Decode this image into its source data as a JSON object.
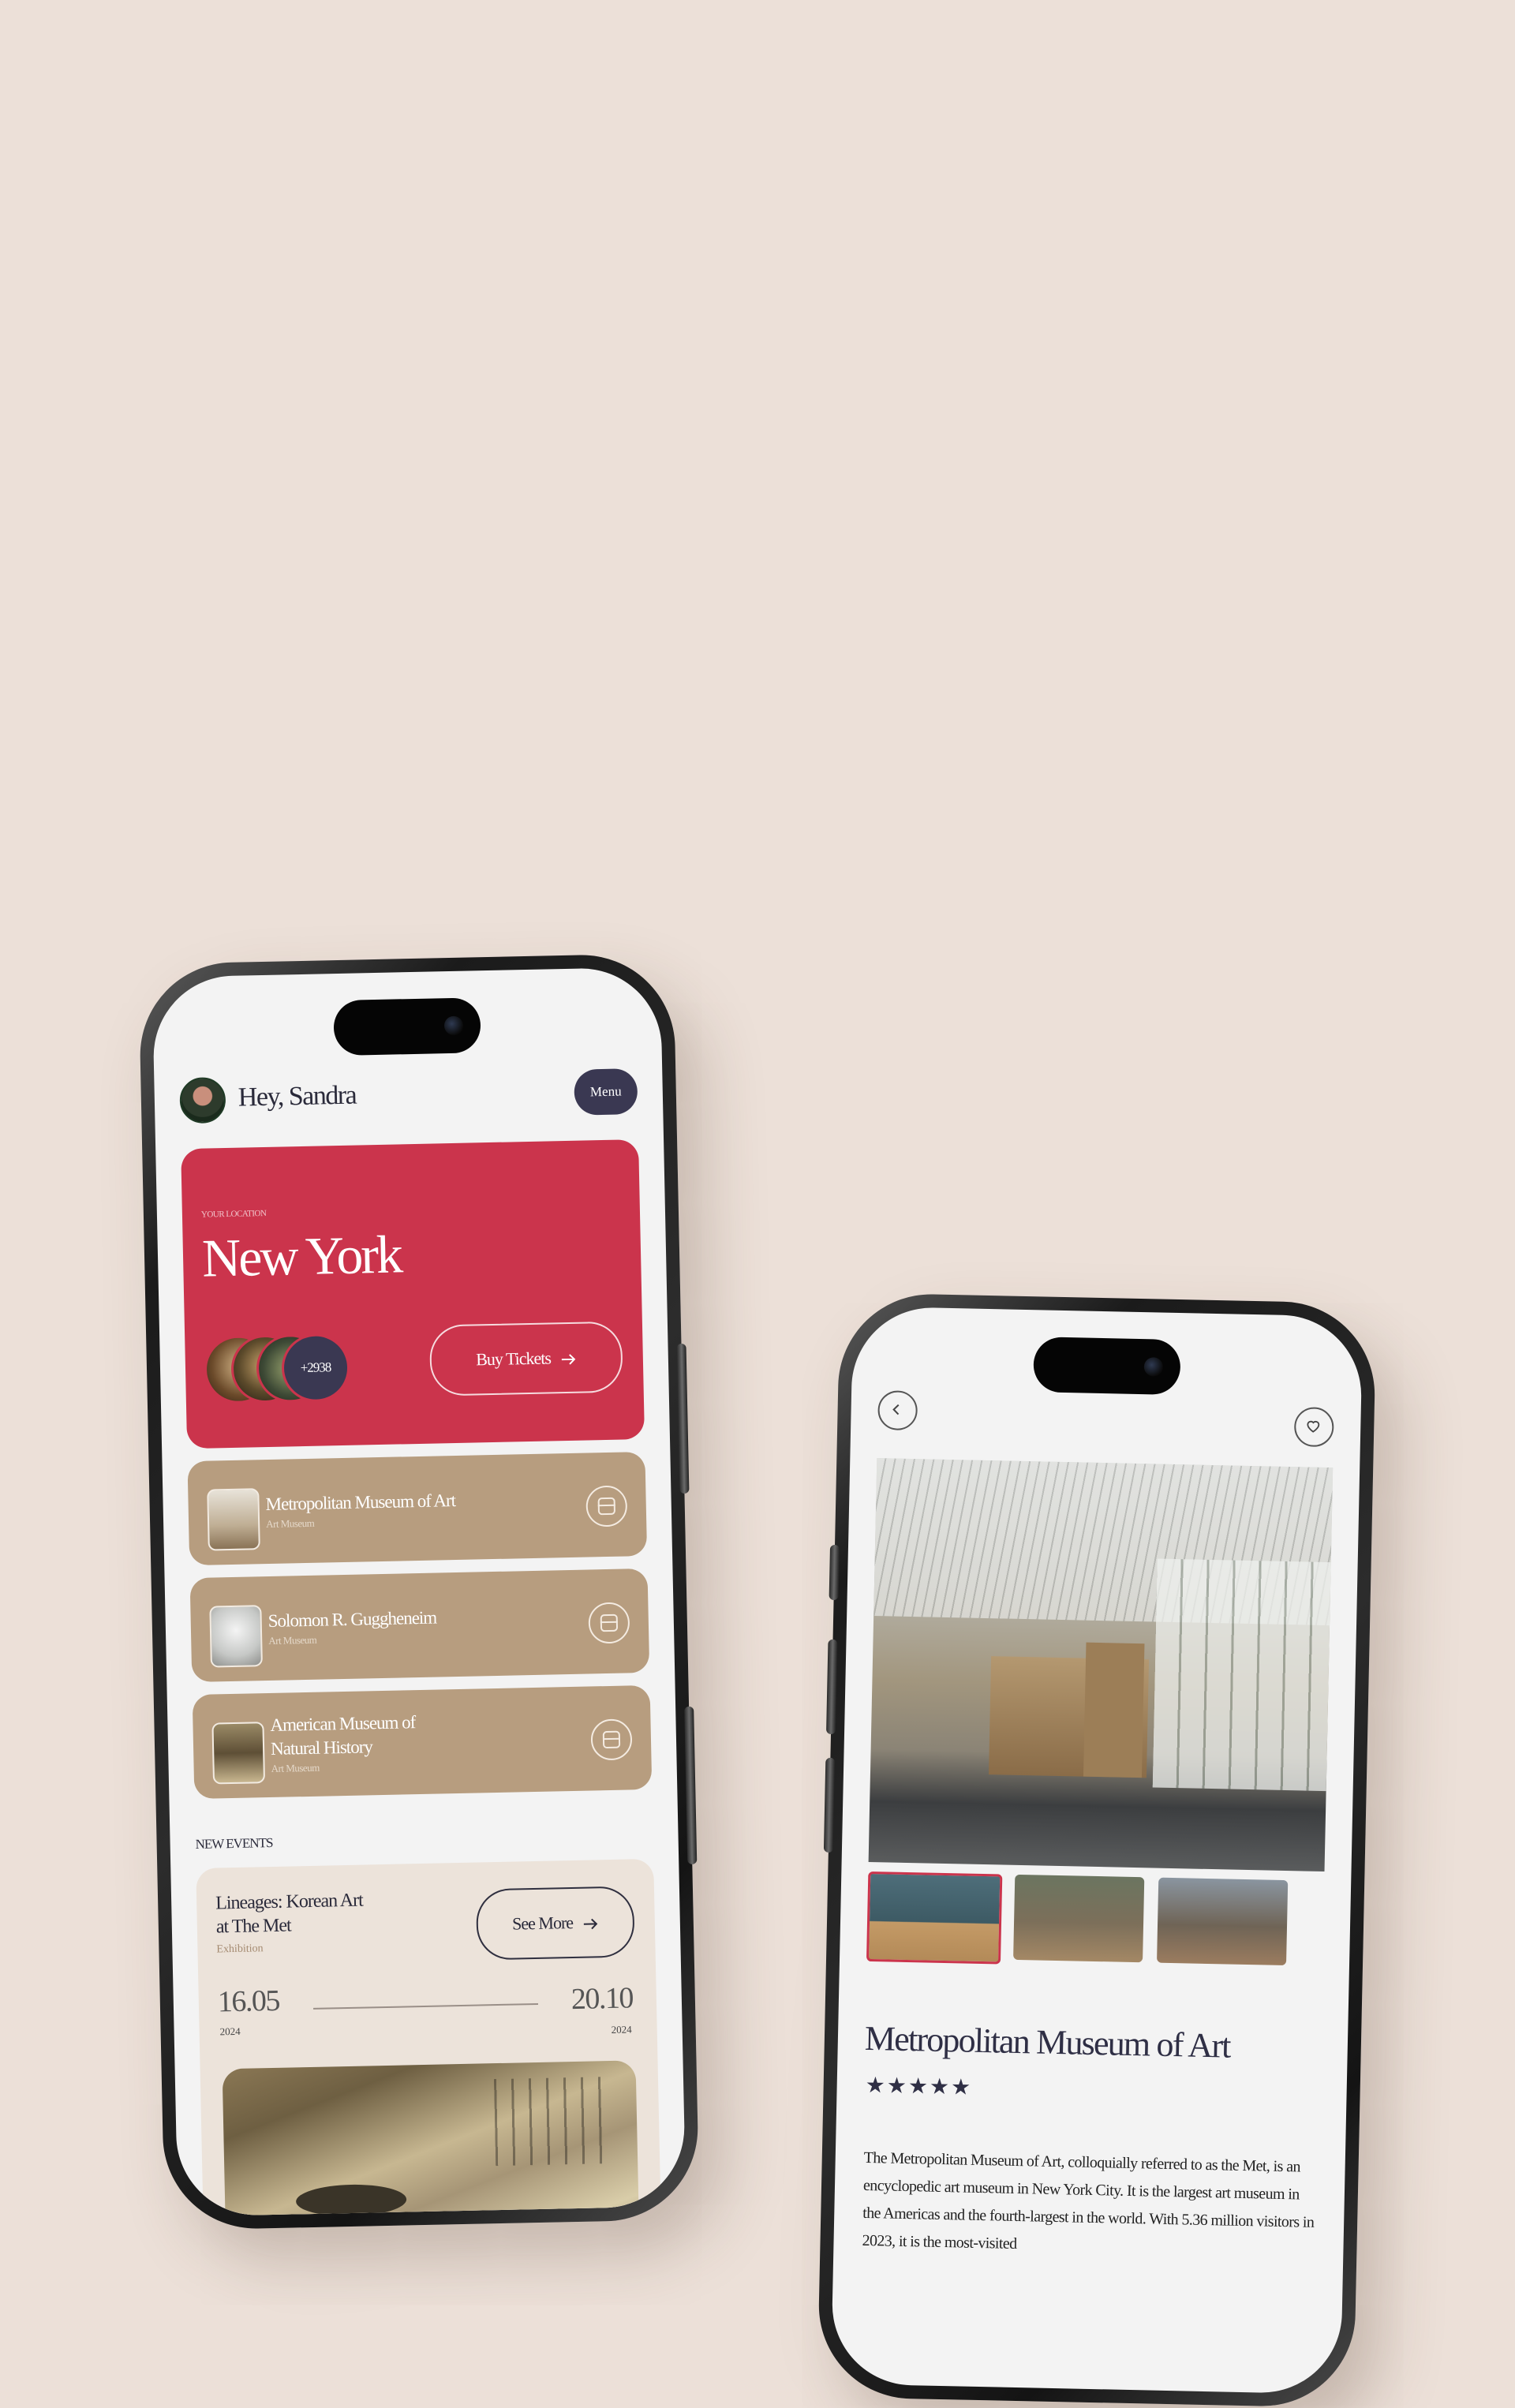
{
  "home_screen": {
    "greeting": "Hey, Sandra",
    "menu_label": "Menu",
    "location": {
      "label": "YOUR LOCATION",
      "city": "New York",
      "visitor_count": "+2938",
      "buy_tickets_label": "Buy Tickets"
    },
    "museums": [
      {
        "name": "Metropolitan Museum of Art",
        "type": "Art Museum"
      },
      {
        "name": "Solomon R. Guggheneim",
        "type": "Art Museum"
      },
      {
        "name": "American Museum of Natural History",
        "type": "Art Museum"
      }
    ],
    "section_title": "NEW EVENTS",
    "event": {
      "title": "Lineages: Korean Art at The Met",
      "type": "Exhibition",
      "see_more_label": "See More",
      "start_date": "16.05",
      "start_year": "2024",
      "end_date": "20.10",
      "end_year": "2024"
    }
  },
  "detail_screen": {
    "title": "Metropolitan Museum of Art",
    "rating": 4.5,
    "stars_text": "★★★★★",
    "description": "The Metropolitan Museum of Art, colloquially referred to as the Met, is an encyclopedic art museum in New York City. It is the largest art museum in the Americas and the fourth-largest in the world. With 5.36 million visitors in 2023, it is the most-visited",
    "gallery_selected_index": 0
  },
  "colors": {
    "background": "#ece0d8",
    "accent_red": "#cb344c",
    "museum_card": "#b79d7f",
    "navy": "#3a3852"
  },
  "icons": [
    "arrow-right-icon",
    "ticket-icon",
    "chevron-left-icon",
    "heart-icon",
    "star-icon"
  ]
}
